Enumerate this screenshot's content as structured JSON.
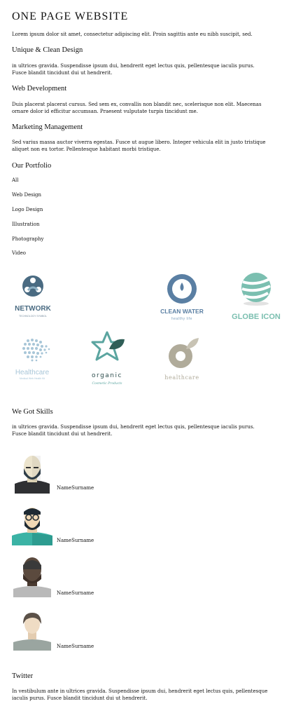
{
  "header": {
    "title": "ONE PAGE WEBSITE",
    "intro": "Lorem ipsum dolor sit amet, consectetur adipiscing elit. Proin sagittis ante eu nibh suscipit, sed."
  },
  "services": [
    {
      "title": "Unique & Clean Design",
      "text": "in ultrices gravida. Suspendisse ipsum dui, hendrerit eget lectus quis, pellentesque iaculis purus. Fusce blandit tincidunt dui ut hendrerit."
    },
    {
      "title": "Web Development",
      "text": "Duis placerat placerat cursus. Sed sem ex, convallis non blandit nec, scelerisque non elit. Maecenas ornare dolor id efficitur accumsan. Praesent vulputate turpis tincidunt me."
    },
    {
      "title": "Marketing Management",
      "text": "Sed varius massa auctor viverra egestas. Fusce ut augue libero. Integer vehicula elit in justo tristique aliquet non eu tortor. Pellentesque habitant morbi tristique."
    }
  ],
  "portfolio": {
    "title": "Our Portfolio",
    "filters": [
      "All",
      "Web Design",
      "Logo Design",
      "Illustration",
      "Photography",
      "Video"
    ],
    "logos": [
      {
        "name": "NETWORK",
        "sub": "TECHNOLOGY SYMBOL",
        "color": "#4a6b82"
      },
      {
        "name": "CLEAN WATER",
        "sub": "healthy life",
        "color": "#5a7fa3"
      },
      {
        "name": "GLOBE ICON",
        "sub": "",
        "color": "#7bbfb0"
      },
      {
        "name": "Healthcare",
        "sub": "Medical Web Health Kit",
        "color": "#a8c6d8"
      },
      {
        "name": "organic",
        "sub": "Cosmetic Products",
        "color": "#4a8f8a"
      },
      {
        "name": "healthcare",
        "sub": "",
        "color": "#b0ab9a"
      }
    ]
  },
  "skills": {
    "title": "We Got Skills",
    "text": "in ultrices gravida. Suspendisse ipsum dui, hendrerit eget lectus quis, pellentesque iaculis purus. Fusce blandit tincidunt dui ut hendrerit.",
    "members": [
      {
        "name": "NameSurname"
      },
      {
        "name": "NameSurname"
      },
      {
        "name": "NameSurname"
      },
      {
        "name": "NameSurname"
      }
    ]
  },
  "twitter": {
    "title": "Twitter",
    "text": "In vestibulum ante in ultrices gravida. Suspendisse ipsum dui, hendrerit eget lectus quis, pellentesque iaculis purus. Fusce blandit tincidunt dui ut hendrerit."
  }
}
